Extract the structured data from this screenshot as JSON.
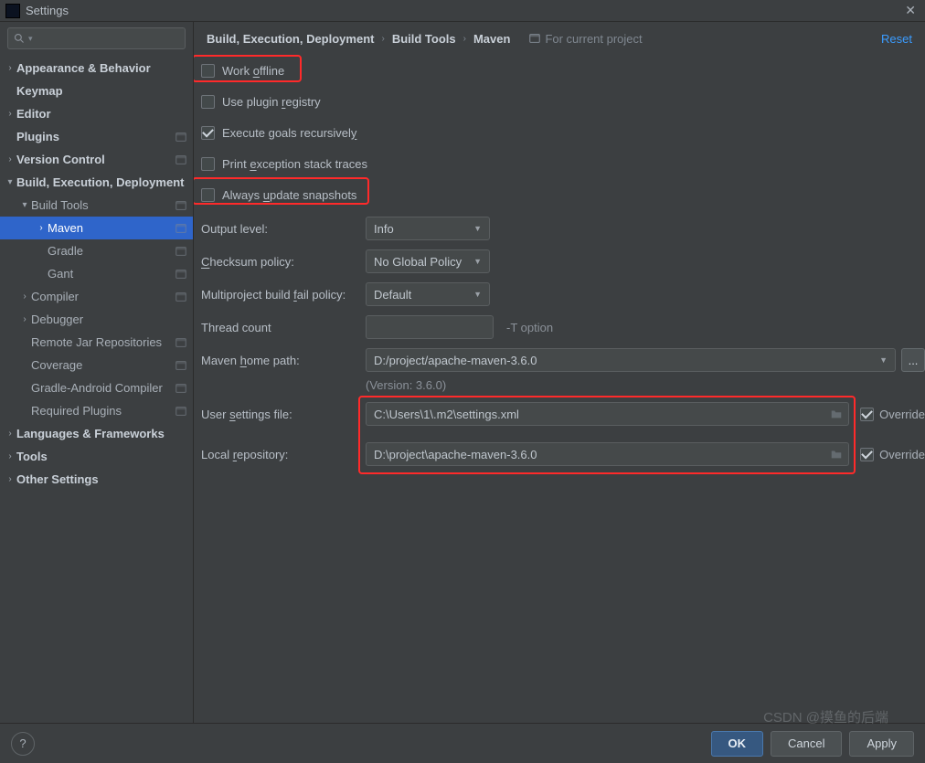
{
  "window": {
    "title": "Settings",
    "close_glyph": "✕"
  },
  "search": {
    "placeholder": ""
  },
  "sidebar": {
    "items": [
      {
        "label": "Appearance & Behavior",
        "arrow": ">",
        "bold": true,
        "pad": 0
      },
      {
        "label": "Keymap",
        "arrow": "",
        "bold": true,
        "pad": 0
      },
      {
        "label": "Editor",
        "arrow": ">",
        "bold": true,
        "pad": 0
      },
      {
        "label": "Plugins",
        "arrow": "",
        "bold": true,
        "pad": 0,
        "proj": true
      },
      {
        "label": "Version Control",
        "arrow": ">",
        "bold": true,
        "pad": 0,
        "proj": true
      },
      {
        "label": "Build, Execution, Deployment",
        "arrow": "v",
        "bold": true,
        "pad": 0
      },
      {
        "label": "Build Tools",
        "arrow": "v",
        "bold": false,
        "pad": 1,
        "proj": true
      },
      {
        "label": "Maven",
        "arrow": ">",
        "bold": false,
        "pad": 2,
        "proj": true,
        "sel": true
      },
      {
        "label": "Gradle",
        "arrow": "",
        "bold": false,
        "pad": 2,
        "proj": true
      },
      {
        "label": "Gant",
        "arrow": "",
        "bold": false,
        "pad": 2,
        "proj": true
      },
      {
        "label": "Compiler",
        "arrow": ">",
        "bold": false,
        "pad": 1,
        "proj": true
      },
      {
        "label": "Debugger",
        "arrow": ">",
        "bold": false,
        "pad": 1
      },
      {
        "label": "Remote Jar Repositories",
        "arrow": "",
        "bold": false,
        "pad": 1,
        "proj": true
      },
      {
        "label": "Coverage",
        "arrow": "",
        "bold": false,
        "pad": 1,
        "proj": true
      },
      {
        "label": "Gradle-Android Compiler",
        "arrow": "",
        "bold": false,
        "pad": 1,
        "proj": true
      },
      {
        "label": "Required Plugins",
        "arrow": "",
        "bold": false,
        "pad": 1,
        "proj": true
      },
      {
        "label": "Languages & Frameworks",
        "arrow": ">",
        "bold": true,
        "pad": 0
      },
      {
        "label": "Tools",
        "arrow": ">",
        "bold": true,
        "pad": 0
      },
      {
        "label": "Other Settings",
        "arrow": ">",
        "bold": true,
        "pad": 0
      }
    ]
  },
  "breadcrumb": {
    "a": "Build, Execution, Deployment",
    "b": "Build Tools",
    "c": "Maven",
    "scope": "For current project",
    "reset": "Reset"
  },
  "checks": {
    "work_offline": {
      "label_pre": "Work ",
      "mn": "o",
      "label_post": "ffline",
      "checked": false
    },
    "plugin_registry": {
      "label_pre": "Use plugin ",
      "mn": "r",
      "label_post": "egistry",
      "checked": false
    },
    "exec_recursive": {
      "label_pre": "Execute goals recursivel",
      "mn": "y",
      "label_post": "",
      "checked": true
    },
    "print_exc": {
      "label_pre": "Print ",
      "mn": "e",
      "label_post": "xception stack traces",
      "checked": false
    },
    "update_snap": {
      "label_pre": "Always ",
      "mn": "u",
      "label_post": "pdate snapshots",
      "checked": false
    }
  },
  "fields": {
    "output_level": {
      "label": "Output level:",
      "value": "Info"
    },
    "checksum": {
      "label_pre": "",
      "mn": "C",
      "label_post": "hecksum policy:",
      "value": "No Global Policy"
    },
    "multiproject": {
      "label_pre": "Multiproject build ",
      "mn": "f",
      "label_post": "ail policy:",
      "value": "Default"
    },
    "thread": {
      "label": "Thread count",
      "value": "",
      "hint": "-T option"
    },
    "maven_home": {
      "label_pre": "Maven ",
      "mn": "h",
      "label_post": "ome path:",
      "value": "D:/project/apache-maven-3.6.0",
      "browse": "..."
    },
    "version": "(Version: 3.6.0)",
    "user_settings": {
      "label_pre": "User ",
      "mn": "s",
      "label_post": "ettings file:",
      "value": "C:\\Users\\1\\.m2\\settings.xml"
    },
    "local_repo": {
      "label_pre": "Local ",
      "mn": "r",
      "label_post": "epository:",
      "value": "D:\\project\\apache-maven-3.6.0"
    },
    "override": "Override"
  },
  "footer": {
    "ok": "OK",
    "cancel": "Cancel",
    "apply": "Apply",
    "help": "?"
  },
  "watermark": "CSDN @摸鱼的后端"
}
